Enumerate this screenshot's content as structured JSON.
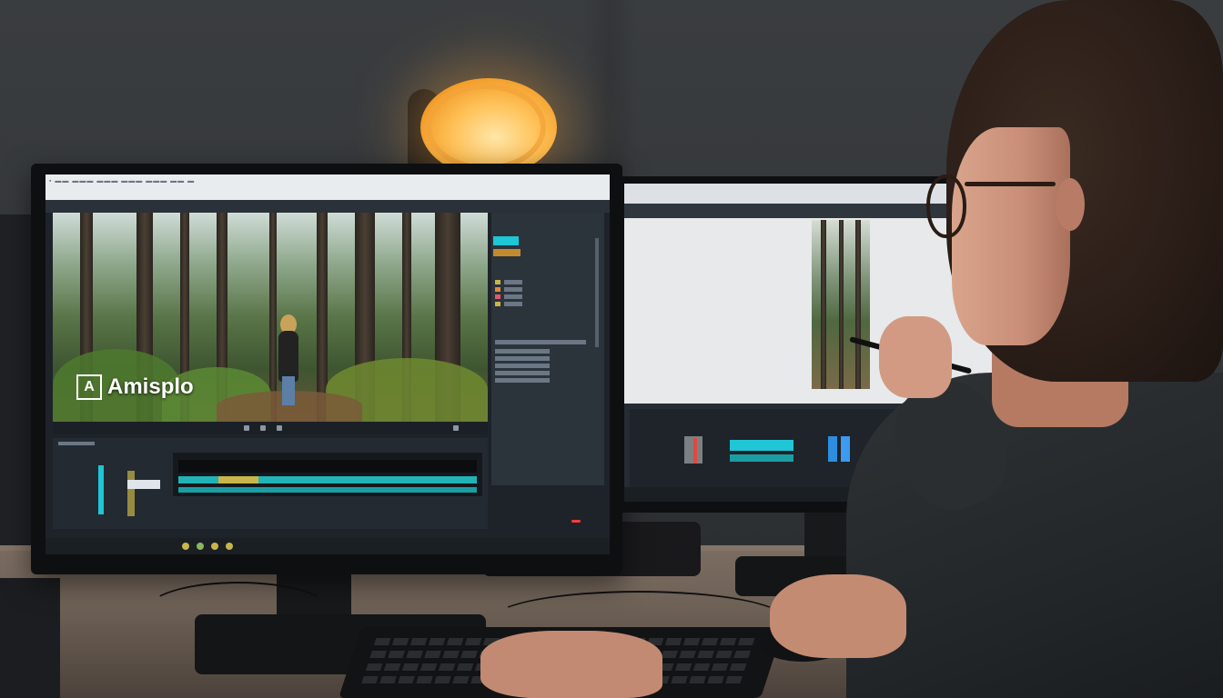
{
  "scene": {
    "brand_logo_mark": "A",
    "brand_text": "Amisplo"
  },
  "colors": {
    "accent_teal": "#1ec6d6",
    "lamp_glow": "#ffc259",
    "power_led": "#ff3b3b"
  },
  "icons": [
    "brand-logo-icon",
    "lamp",
    "keyboard",
    "mouse"
  ]
}
